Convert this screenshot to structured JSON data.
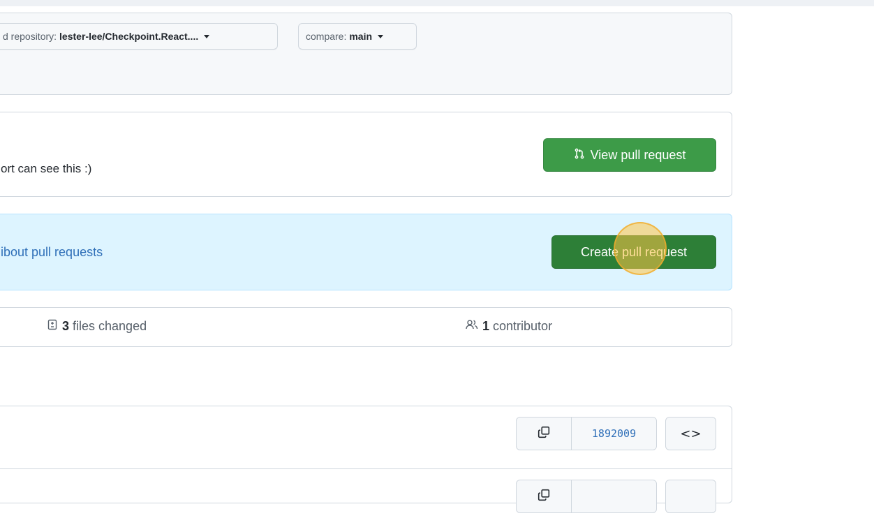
{
  "range": {
    "base_repo_prefix": "d repository:",
    "base_repo_value": "lester-lee/Checkpoint.React....",
    "compare_prefix": "compare:",
    "compare_value": "main"
  },
  "existing_pr": {
    "text": "ort can see this :)",
    "view_button_label": "View pull request",
    "icon": "git-pull-request-icon"
  },
  "create_pr": {
    "link_text": "ibout pull requests",
    "button_label": "Create pull request"
  },
  "summary": {
    "files_count": "3",
    "files_label": "files changed",
    "files_icon": "file-diff-icon",
    "contributors_count": "1",
    "contributors_label": "contributor",
    "contributors_icon": "people-icon"
  },
  "commits": [
    {
      "sha": "1892009",
      "copy_icon": "copy-icon",
      "browse_label": "<>"
    },
    {
      "sha": "",
      "copy_icon": "copy-icon",
      "browse_label": ""
    }
  ],
  "colors": {
    "green_button": "#3d9b48",
    "create_button": "#2d7f37",
    "link_blue": "#2f6fb8",
    "info_background": "#ddf4ff",
    "click_marker": "#ffc446"
  }
}
